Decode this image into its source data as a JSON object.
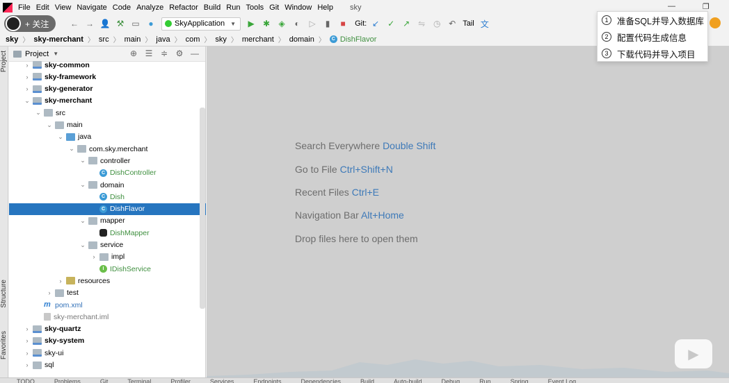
{
  "window": {
    "project_title": "sky"
  },
  "menu": [
    "File",
    "Edit",
    "View",
    "Navigate",
    "Code",
    "Analyze",
    "Refactor",
    "Build",
    "Run",
    "Tools",
    "Git",
    "Window",
    "Help"
  ],
  "watermark": {
    "follow_label": "+ 关注"
  },
  "toolbar": {
    "run_config": "SkyApplication",
    "git_label": "Git:",
    "tail_label": "Tail"
  },
  "breadcrumb": [
    "sky",
    "sky-merchant",
    "src",
    "main",
    "java",
    "com",
    "sky",
    "merchant",
    "domain",
    "DishFlavor"
  ],
  "left_tabs": {
    "project": "Project",
    "structure": "Structure",
    "favorites": "Favorites"
  },
  "project_panel": {
    "title": "Project"
  },
  "tree": [
    {
      "label": "sky-common",
      "depth": 0,
      "arrow": "›",
      "icon": "module",
      "style": "bold"
    },
    {
      "label": "sky-framework",
      "depth": 0,
      "arrow": "›",
      "icon": "module",
      "style": "bold"
    },
    {
      "label": "sky-generator",
      "depth": 0,
      "arrow": "›",
      "icon": "module",
      "style": "bold"
    },
    {
      "label": "sky-merchant",
      "depth": 0,
      "arrow": "⌄",
      "icon": "module",
      "style": "bold"
    },
    {
      "label": "src",
      "depth": 1,
      "arrow": "⌄",
      "icon": "folder",
      "style": ""
    },
    {
      "label": "main",
      "depth": 2,
      "arrow": "⌄",
      "icon": "folder",
      "style": ""
    },
    {
      "label": "java",
      "depth": 3,
      "arrow": "⌄",
      "icon": "src",
      "style": ""
    },
    {
      "label": "com.sky.merchant",
      "depth": 4,
      "arrow": "⌄",
      "icon": "folder",
      "style": ""
    },
    {
      "label": "controller",
      "depth": 5,
      "arrow": "⌄",
      "icon": "folder",
      "style": ""
    },
    {
      "label": "DishController",
      "depth": 6,
      "arrow": "",
      "icon": "cls",
      "style": "green"
    },
    {
      "label": "domain",
      "depth": 5,
      "arrow": "⌄",
      "icon": "folder",
      "style": ""
    },
    {
      "label": "Dish",
      "depth": 6,
      "arrow": "",
      "icon": "cls",
      "style": "green"
    },
    {
      "label": "DishFlavor",
      "depth": 6,
      "arrow": "",
      "icon": "cls",
      "style": "green",
      "selected": true
    },
    {
      "label": "mapper",
      "depth": 5,
      "arrow": "⌄",
      "icon": "folder",
      "style": ""
    },
    {
      "label": "DishMapper",
      "depth": 6,
      "arrow": "",
      "icon": "mapper",
      "style": "green"
    },
    {
      "label": "service",
      "depth": 5,
      "arrow": "⌄",
      "icon": "folder",
      "style": ""
    },
    {
      "label": "impl",
      "depth": 6,
      "arrow": "›",
      "icon": "folder",
      "style": ""
    },
    {
      "label": "IDishService",
      "depth": 6,
      "arrow": "",
      "icon": "itf",
      "style": "green"
    },
    {
      "label": "resources",
      "depth": 3,
      "arrow": "›",
      "icon": "res",
      "style": ""
    },
    {
      "label": "test",
      "depth": 2,
      "arrow": "›",
      "icon": "folder",
      "style": ""
    },
    {
      "label": "pom.xml",
      "depth": 1,
      "arrow": "",
      "icon": "pom",
      "style": "blue"
    },
    {
      "label": "sky-merchant.iml",
      "depth": 1,
      "arrow": "",
      "icon": "iml",
      "style": "gray"
    },
    {
      "label": "sky-quartz",
      "depth": 0,
      "arrow": "›",
      "icon": "module",
      "style": "bold"
    },
    {
      "label": "sky-system",
      "depth": 0,
      "arrow": "›",
      "icon": "module",
      "style": "bold"
    },
    {
      "label": "sky-ui",
      "depth": 0,
      "arrow": "›",
      "icon": "module",
      "style": ""
    },
    {
      "label": "sql",
      "depth": 0,
      "arrow": "›",
      "icon": "folder",
      "style": ""
    }
  ],
  "editor_hints": [
    {
      "text": "Search Everywhere",
      "key": "Double Shift"
    },
    {
      "text": "Go to File",
      "key": "Ctrl+Shift+N"
    },
    {
      "text": "Recent Files",
      "key": "Ctrl+E"
    },
    {
      "text": "Navigation Bar",
      "key": "Alt+Home"
    },
    {
      "text": "Drop files here to open them",
      "key": ""
    }
  ],
  "popup": [
    {
      "num": "1",
      "label": "准备SQL并导入数据库"
    },
    {
      "num": "2",
      "label": "配置代码生成信息"
    },
    {
      "num": "3",
      "label": "下载代码并导入项目"
    }
  ],
  "bottom_tabs": [
    "TODO",
    "Problems",
    "Git",
    "Terminal",
    "Profiler",
    "Services",
    "Endpoints",
    "Dependencies",
    "Build",
    "Auto-build",
    "Debug",
    "Run",
    "Spring",
    "Event Log"
  ]
}
